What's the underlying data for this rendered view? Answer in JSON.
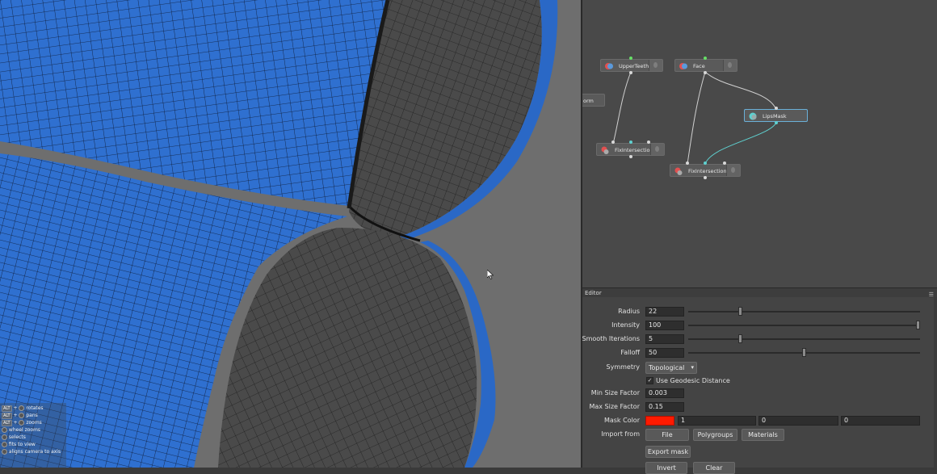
{
  "graph": {
    "nodes": {
      "upper_teeth": "UpperTeeth",
      "face": "Face",
      "orm": "orm",
      "lips_mask": "LipsMask",
      "fix_intersections": "FixIntersections",
      "fix_intersections1": "FixIntersections1"
    }
  },
  "editor": {
    "title": "Editor",
    "radius": {
      "label": "Radius",
      "value": "22",
      "level": 0.22
    },
    "intensity": {
      "label": "Intensity",
      "value": "100",
      "level": 1.0
    },
    "smooth_iterations": {
      "label": "Smooth Iterations",
      "value": "5",
      "level": 0.22
    },
    "falloff": {
      "label": "Falloff",
      "value": "50",
      "level": 0.5
    },
    "symmetry": {
      "label": "Symmetry",
      "value": "Topological"
    },
    "geodesic": {
      "label": "Use Geodesic Distance",
      "checked": true,
      "mark": "✓"
    },
    "min_size": {
      "label": "Min Size Factor",
      "value": "0.003"
    },
    "max_size": {
      "label": "Max Size Factor",
      "value": "0.15"
    },
    "mask_color": {
      "label": "Mask Color",
      "swatch": "#ff1a00",
      "r": "1",
      "g": "0",
      "b": "0"
    },
    "import_from": {
      "label": "Import from",
      "file": "File",
      "polygroups": "Polygroups",
      "materials": "Materials"
    },
    "export_mask": "Export mask",
    "invert": "Invert",
    "clear": "Clear"
  },
  "help": {
    "rotate": "rotates",
    "pan": "pans",
    "zoom": "zooms",
    "wheel_zoom": "wheel zooms",
    "select": "selects",
    "fit": "fits to view",
    "align": "aligns camera to axis",
    "alt_key": "ALT"
  },
  "colors": {
    "mesh_blue": "#2e6ecc",
    "mesh_gray": "#4a4a4a",
    "accent": "#5fd0cf"
  }
}
